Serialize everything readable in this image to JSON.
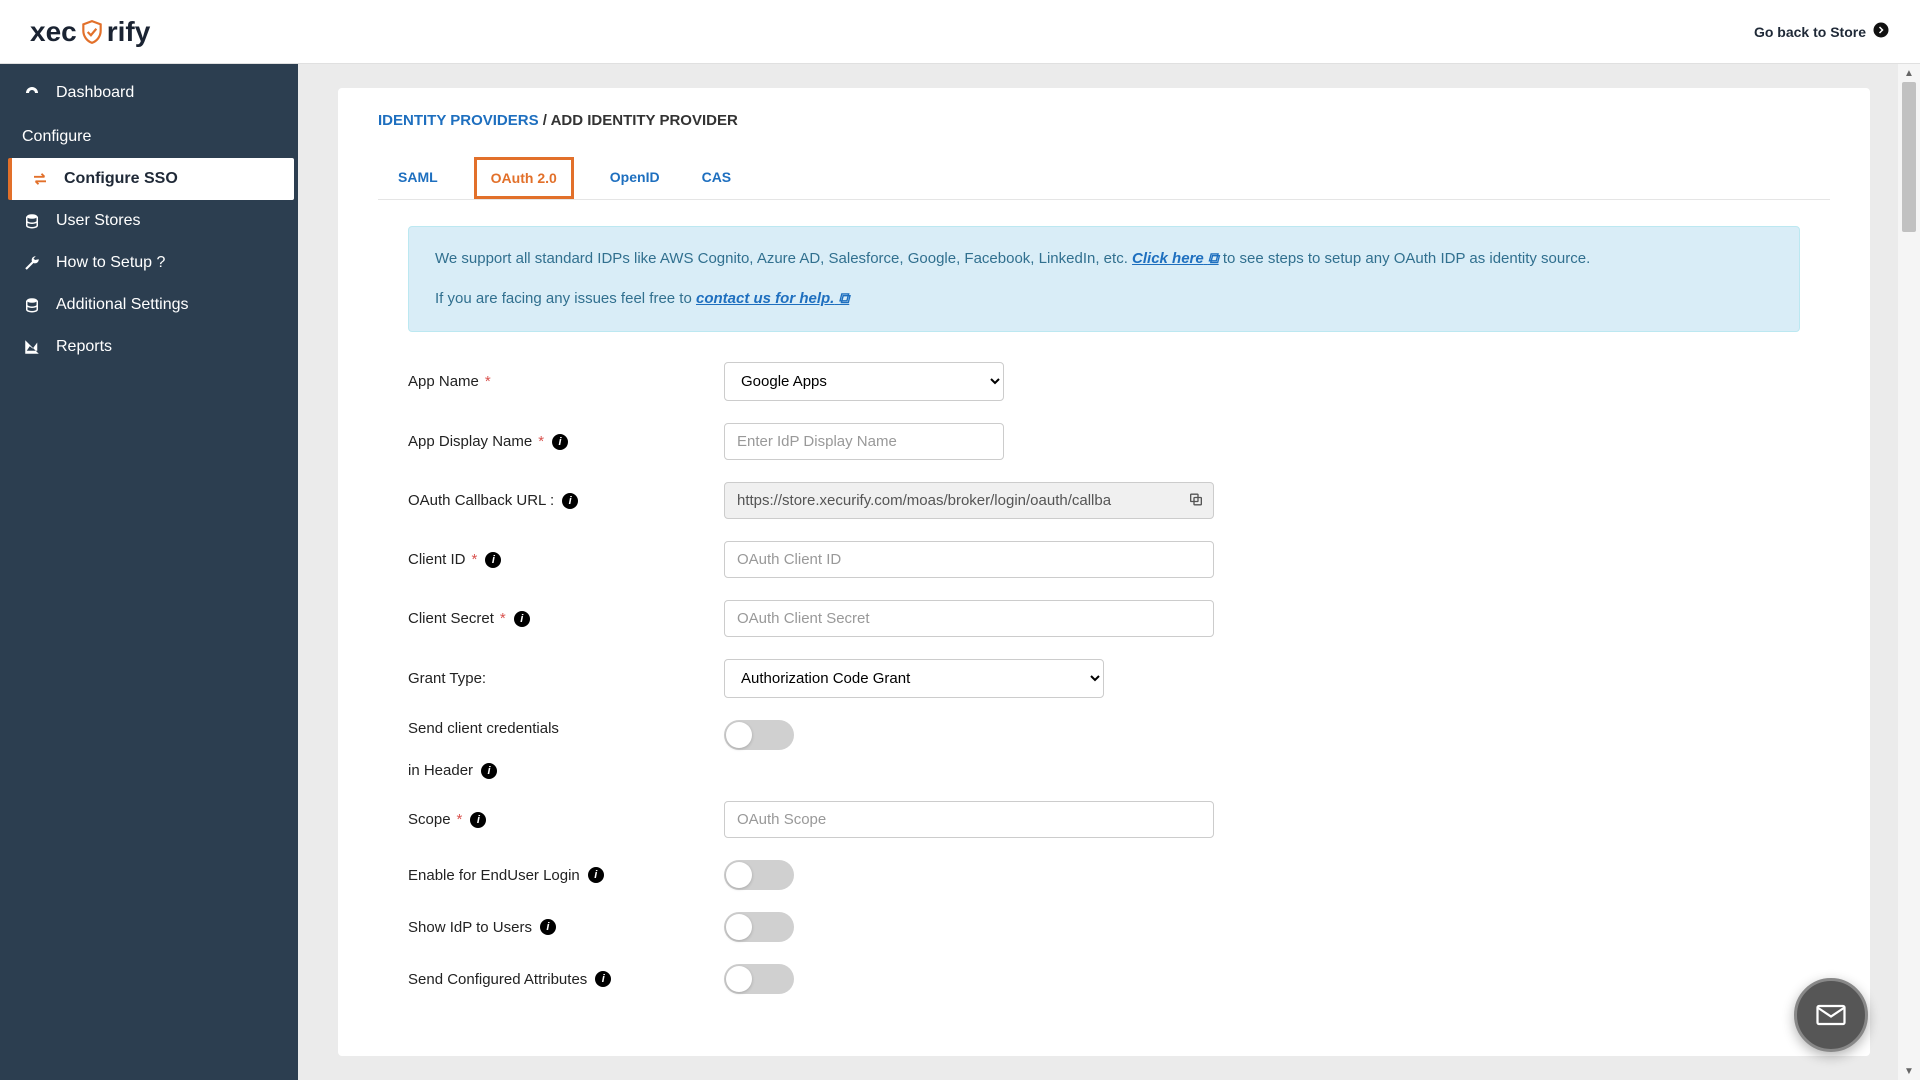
{
  "header": {
    "logo_prefix": "xec",
    "logo_suffix": "rify",
    "back_link": "Go back to Store"
  },
  "sidebar": {
    "dashboard": "Dashboard",
    "configure_label": "Configure",
    "configure_sso": "Configure SSO",
    "user_stores": "User Stores",
    "how_to_setup": "How to Setup ?",
    "additional_settings": "Additional Settings",
    "reports": "Reports"
  },
  "breadcrumb": {
    "root": "IDENTITY PROVIDERS",
    "sep": "/",
    "current": "ADD IDENTITY PROVIDER"
  },
  "tabs": {
    "saml": "SAML",
    "oauth": "OAuth 2.0",
    "openid": "OpenID",
    "cas": "CAS"
  },
  "info": {
    "line1_pre": "We support all standard IDPs like AWS Cognito, Azure AD, Salesforce, Google, Facebook, LinkedIn, etc. ",
    "click_here": "Click here",
    "line1_post": " to see steps to setup any OAuth IDP as identity source.",
    "line2_pre": "If you are facing any issues feel free to ",
    "contact": "contact us for help."
  },
  "form": {
    "app_name_label": "App Name",
    "app_name_value": "Google Apps",
    "display_name_label": "App Display Name",
    "display_name_placeholder": "Enter IdP Display Name",
    "callback_label": "OAuth Callback URL :",
    "callback_value": "https://store.xecurify.com/moas/broker/login/oauth/callba",
    "client_id_label": "Client ID",
    "client_id_placeholder": "OAuth Client ID",
    "client_secret_label": "Client Secret",
    "client_secret_placeholder": "OAuth Client Secret",
    "grant_type_label": "Grant Type:",
    "grant_type_value": "Authorization Code Grant",
    "send_header_label_1": "Send client credentials",
    "send_header_label_2": "in Header",
    "scope_label": "Scope",
    "scope_placeholder": "OAuth Scope",
    "enable_enduser_label": "Enable for EndUser Login",
    "show_idp_label": "Show IdP to Users",
    "send_attrs_label": "Send Configured Attributes"
  }
}
